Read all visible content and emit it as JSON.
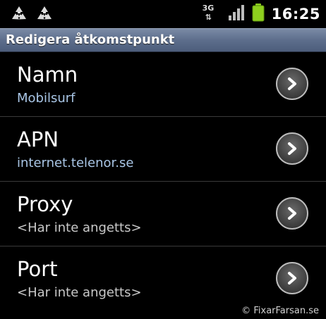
{
  "status_bar": {
    "notifications": [
      "recycle-icon",
      "recycle-icon"
    ],
    "network_type": "3G",
    "network_arrows": "⇅",
    "signal_icon": "signal-icon",
    "battery_icon": "battery-icon",
    "battery_color": "#8ed01e",
    "time": "16:25"
  },
  "header": {
    "title": "Redigera åtkomstpunkt",
    "background_color": "#5d6e8c"
  },
  "settings": [
    {
      "title": "Namn",
      "summary": "Mobilsurf"
    },
    {
      "title": "APN",
      "summary": "internet.telenor.se"
    },
    {
      "title": "Proxy",
      "summary": "<Har inte angetts>"
    },
    {
      "title": "Port",
      "summary": "<Har inte angetts>"
    }
  ],
  "watermark": "© FixarFarsan.se",
  "colors": {
    "summary_set": "#a9c6e6",
    "summary_unset": "#c9c9c9"
  }
}
